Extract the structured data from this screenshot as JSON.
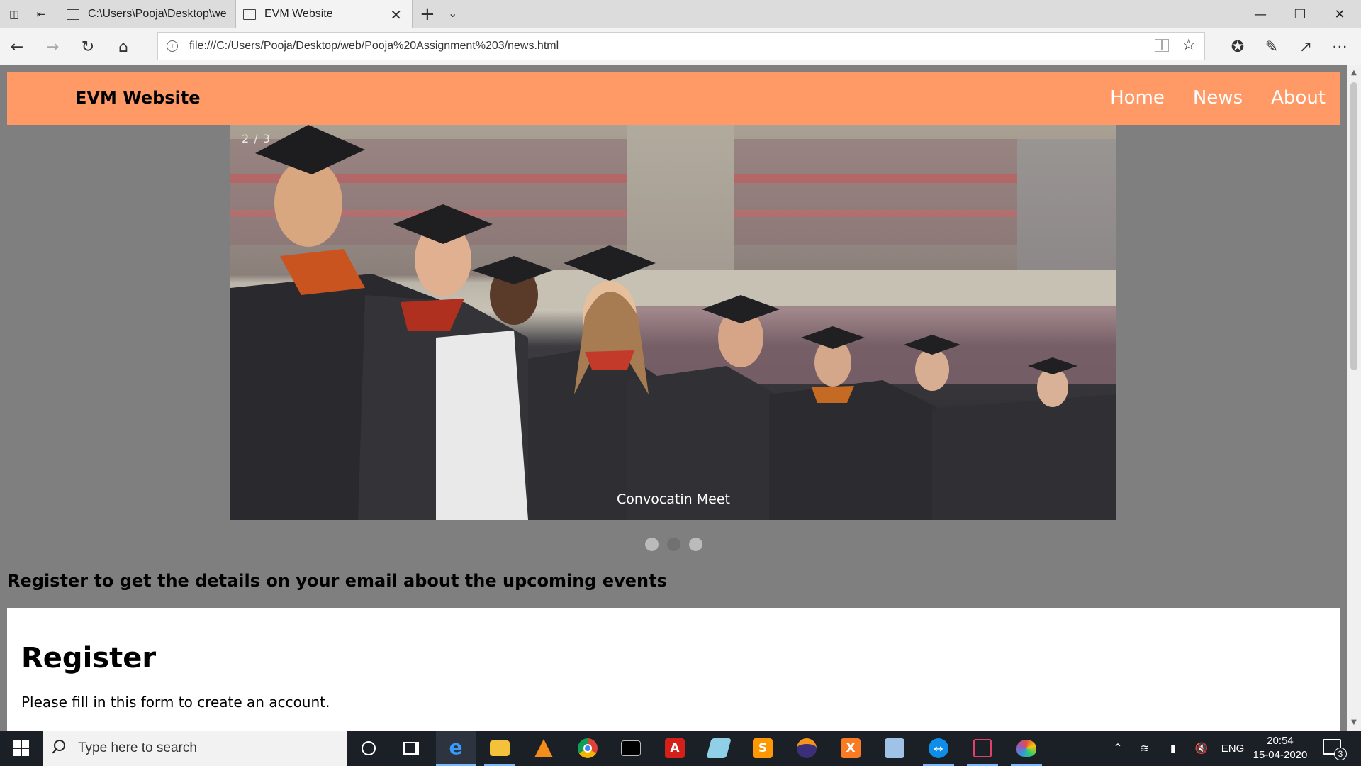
{
  "browser": {
    "tabs": [
      {
        "title": "C:\\Users\\Pooja\\Desktop\\we",
        "active": false
      },
      {
        "title": "EVM Website",
        "active": true
      }
    ],
    "address": "file:///C:/Users/Pooja/Desktop/web/Pooja%20Assignment%203/news.html"
  },
  "site": {
    "title": "EVM Website",
    "nav": [
      "Home",
      "News",
      "About"
    ],
    "header_color": "#ff9966"
  },
  "slideshow": {
    "counter": "2 / 3",
    "caption": "Convocatin Meet",
    "active_dot": 2,
    "total": 3
  },
  "content": {
    "register_prompt": "Register to get the details on your email about the upcoming events",
    "form_title": "Register",
    "form_subtitle": "Please fill in this form to create an account."
  },
  "taskbar": {
    "search_placeholder": "Type here to search",
    "apps": [
      "cortana-icon",
      "task-view-icon",
      "edge-icon",
      "file-explorer-icon",
      "vlc-icon",
      "chrome-icon",
      "terminal-icon",
      "acrobat-icon",
      "notepad-icon",
      "sublime-text-icon",
      "eclipse-icon",
      "xampp-icon",
      "virtualbox-icon",
      "teamviewer-icon",
      "mirror-app-icon",
      "paint-icon"
    ],
    "language": "ENG",
    "time": "20:54",
    "date": "15-04-2020",
    "notifications": "3"
  }
}
